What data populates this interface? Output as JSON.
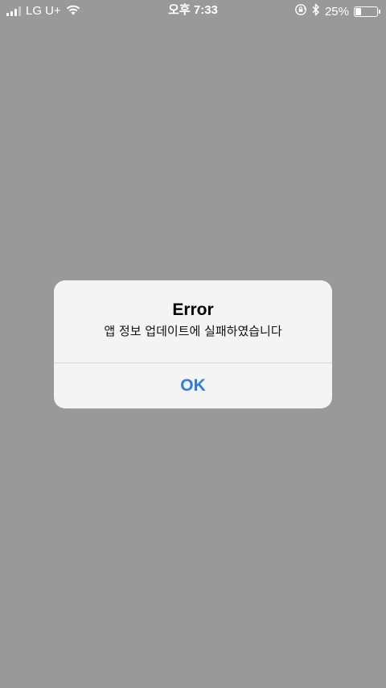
{
  "status_bar": {
    "carrier": "LG U+",
    "time": "오후 7:33",
    "battery_percent": "25%",
    "battery_level": 0.25,
    "icons": [
      "signal-icon",
      "wifi-icon",
      "rotation-lock-icon",
      "bluetooth-icon",
      "battery-icon"
    ]
  },
  "alert": {
    "title": "Error",
    "message": "앱 정보 업데이트에 실패하였습니다",
    "ok_label": "OK",
    "button_color": "#2f7de1"
  },
  "colors": {
    "backdrop": "#999999",
    "alert_background": "#f4f4f4"
  }
}
